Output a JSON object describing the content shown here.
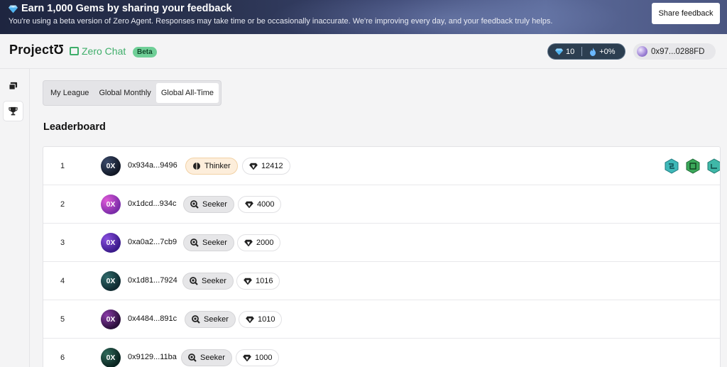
{
  "banner": {
    "title": "Earn 1,000 Gems by sharing your feedback",
    "subtitle": "You're using a beta version of Zero Agent. Responses may take time or be occasionally inaccurate. We're improving every day, and your feedback truly helps.",
    "share_label": "Share feedback"
  },
  "header": {
    "logo": "ProjectƱ",
    "product": "Zero Chat",
    "beta": "Beta",
    "gems": "10",
    "boost": "+0%",
    "wallet": "0x97...0288FD"
  },
  "tabs": [
    "My League",
    "Global Monthly",
    "Global All-Time"
  ],
  "active_tab": "Global All-Time",
  "leaderboard_title": "Leaderboard",
  "rows": [
    {
      "rank": "1",
      "avatar": "0X",
      "address": "0x934a...9496",
      "badge": "Thinker",
      "gems": "12412"
    },
    {
      "rank": "2",
      "avatar": "0X",
      "address": "0x1dcd...934c",
      "badge": "Seeker",
      "gems": "4000"
    },
    {
      "rank": "3",
      "avatar": "0X",
      "address": "0xa0a2...7cb9",
      "badge": "Seeker",
      "gems": "2000"
    },
    {
      "rank": "4",
      "avatar": "0X",
      "address": "0x1d81...7924",
      "badge": "Seeker",
      "gems": "1016"
    },
    {
      "rank": "5",
      "avatar": "0X",
      "address": "0x4484...891c",
      "badge": "Seeker",
      "gems": "1010"
    },
    {
      "rank": "6",
      "avatar": "0X",
      "address": "0x9129...11ba",
      "badge": "Seeker",
      "gems": "1000"
    }
  ],
  "colors": {
    "accent_green": "#3fae6a",
    "beta_bg": "#6fcf97",
    "stats_pill_bg": "#2c3e50",
    "thinker_bg": "#fdeedb"
  }
}
